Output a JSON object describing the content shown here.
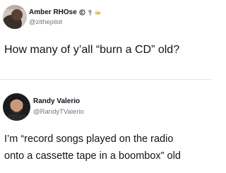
{
  "tweets": [
    {
      "name": "Amber RHOse",
      "handle": "@zithepilot",
      "badge_icons": [
        "copyright-icon",
        "rose-icon",
        "crown-icon"
      ],
      "text_lines": [
        "How many of y’all “burn a CD” old?"
      ]
    },
    {
      "name": "Randy Valerio",
      "handle": "@RandyTValerio",
      "text_lines": [
        "I’m “record songs played on the radio",
        "onto a cassette tape in a boombox” old"
      ]
    }
  ],
  "colors": {
    "background": "#ffffff",
    "text": "#0f1419",
    "secondary_text": "#6b7783",
    "divider": "#e6e6e6"
  }
}
